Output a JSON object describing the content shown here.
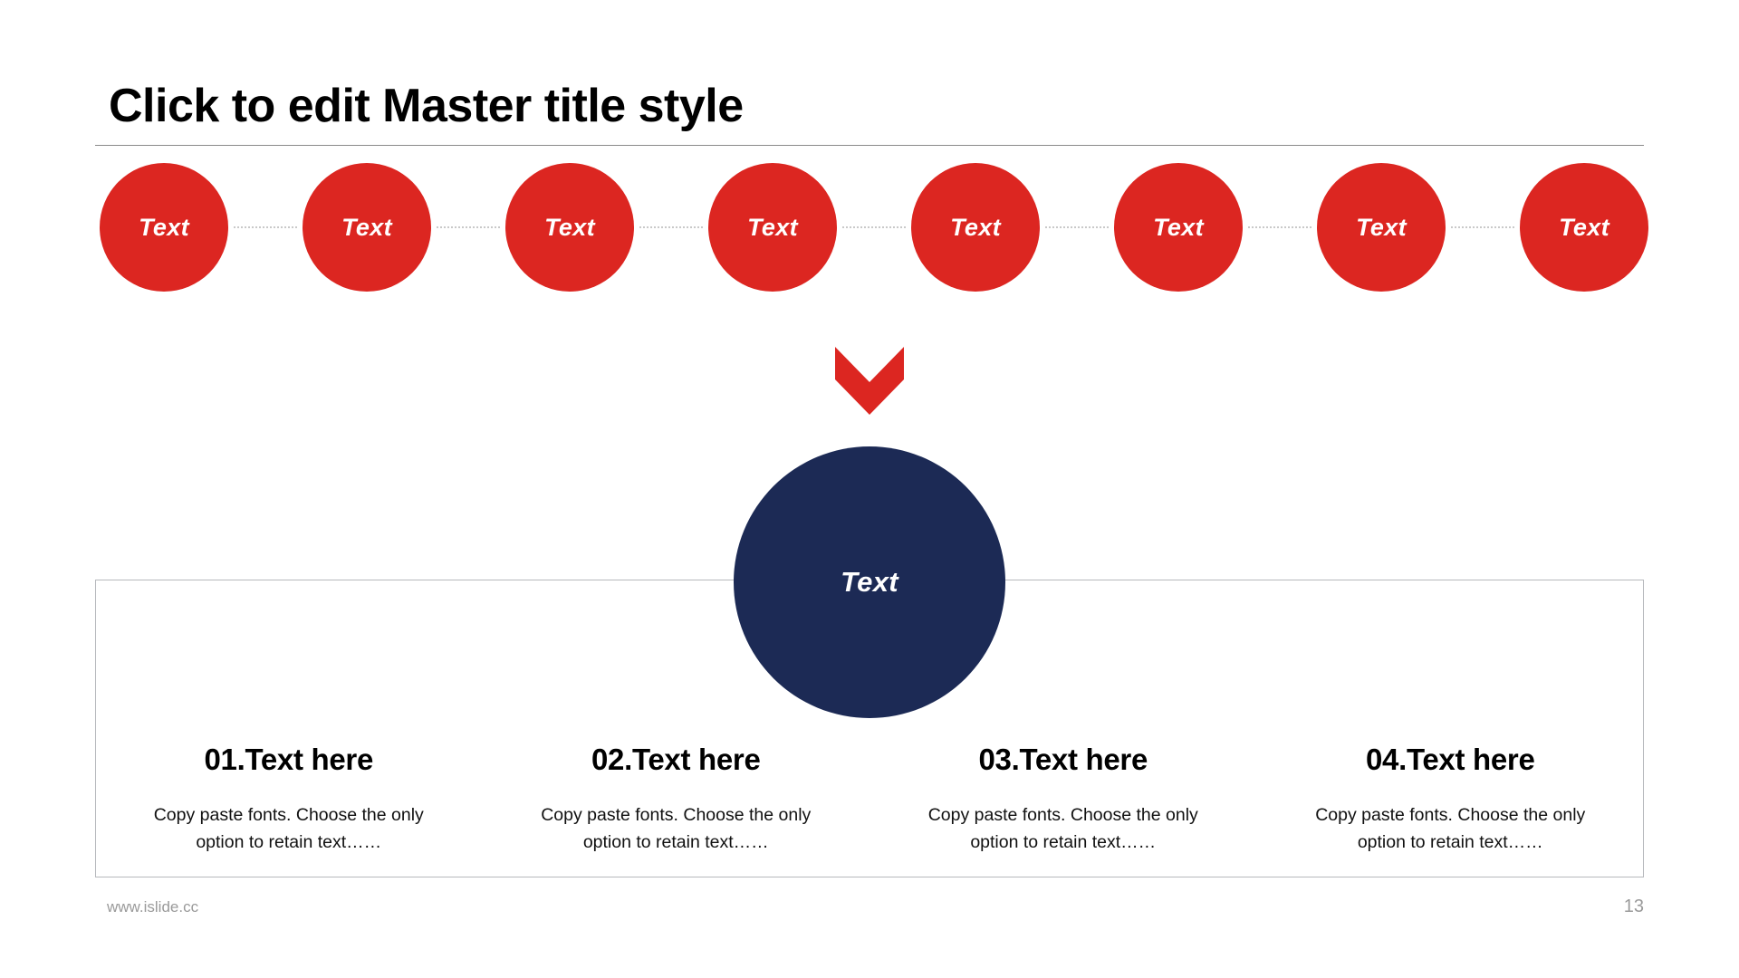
{
  "slide": {
    "title": "Click to edit Master title style",
    "background_color": "#ffffff"
  },
  "colors": {
    "accent_red": "#dc2621",
    "accent_navy": "#1c2a55",
    "rule": "#8a8a8a",
    "box_border": "#b6b8bc",
    "connector": "#c9c9c9",
    "footer_text": "#9a9a9a"
  },
  "circle_row": {
    "count": 8,
    "nodes": [
      {
        "label": "Text"
      },
      {
        "label": "Text"
      },
      {
        "label": "Text"
      },
      {
        "label": "Text"
      },
      {
        "label": "Text"
      },
      {
        "label": "Text"
      },
      {
        "label": "Text"
      },
      {
        "label": "Text"
      }
    ]
  },
  "arrow": {
    "icon": "chevron-down-icon",
    "color": "#dc2621"
  },
  "focus_node": {
    "label": "Text",
    "color": "#1c2a55"
  },
  "columns": [
    {
      "heading": "01.Text here",
      "body": "Copy paste fonts. Choose the only option to retain text……"
    },
    {
      "heading": "02.Text here",
      "body": "Copy paste fonts. Choose the only option to retain text……"
    },
    {
      "heading": "03.Text here",
      "body": "Copy paste fonts. Choose the only option to retain text……"
    },
    {
      "heading": "04.Text here",
      "body": "Copy paste fonts. Choose the only option to retain text……"
    }
  ],
  "footer": {
    "url": "www.islide.cc",
    "page_number": "13"
  }
}
